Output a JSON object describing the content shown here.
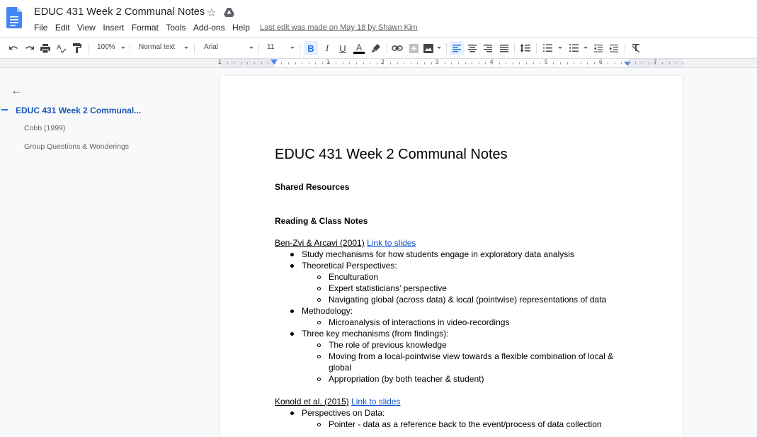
{
  "app": {
    "doc_title": "EDUC 431 Week 2 Communal Notes",
    "last_edit": "Last edit was made on May 18 by Shawn Kim",
    "menu": [
      "File",
      "Edit",
      "View",
      "Insert",
      "Format",
      "Tools",
      "Add-ons",
      "Help"
    ],
    "brand_color": "#4285f4"
  },
  "toolbar": {
    "zoom": "100%",
    "style": "Normal text",
    "font": "Arial",
    "size": "11",
    "icons": [
      "undo-icon",
      "redo-icon",
      "print-icon",
      "spellcheck-icon",
      "paint-format-icon",
      "bold-icon",
      "italic-icon",
      "underline-icon",
      "text-color-icon",
      "highlight-icon",
      "link-icon",
      "comment-icon",
      "image-icon",
      "align-left-icon",
      "align-center-icon",
      "align-right-icon",
      "justify-icon",
      "line-spacing-icon",
      "numbered-list-icon",
      "bulleted-list-icon",
      "decrease-indent-icon",
      "increase-indent-icon",
      "clear-formatting-icon"
    ]
  },
  "ruler": {
    "labels": [
      "1",
      "1",
      "2",
      "3",
      "4",
      "5",
      "6",
      "7"
    ]
  },
  "outline": {
    "title": "EDUC 431 Week 2 Communal...",
    "items": [
      "Cobb (1999)",
      "Group Questions & Wonderings"
    ]
  },
  "document": {
    "title": "EDUC 431 Week 2 Communal Notes",
    "h_shared": "Shared Resources",
    "h_reading": "Reading & Class Notes",
    "ref1": {
      "cite": "Ben-Zvi & Arcavi (2001)",
      "link": "Link to slides"
    },
    "ref1_items": [
      {
        "level": 1,
        "text": "Study mechanisms for how students engage in exploratory data analysis"
      },
      {
        "level": 1,
        "text": "Theoretical Perspectives:"
      },
      {
        "level": 2,
        "text": "Enculturation"
      },
      {
        "level": 2,
        "text": "Expert statisticians’ perspective"
      },
      {
        "level": 2,
        "text": "Navigating global (across data) & local (pointwise) representations of data"
      },
      {
        "level": 1,
        "text": "Methodology:"
      },
      {
        "level": 2,
        "text": "Microanalysis of interactions in video-recordings"
      },
      {
        "level": 1,
        "text": "Three key mechanisms (from findings):"
      },
      {
        "level": 2,
        "text": "The role of previous knowledge"
      },
      {
        "level": 2,
        "text": "Moving from a local-pointwise view towards a flexible combination of local &"
      },
      {
        "level": 3,
        "text": "global"
      },
      {
        "level": 2,
        "text": "Appropriation (by both teacher & student)"
      }
    ],
    "ref2": {
      "cite": "Konold et al. (2015)",
      "link": "Link to slides"
    },
    "ref2_items": [
      {
        "level": 1,
        "text": "Perspectives on Data:"
      },
      {
        "level": 2,
        "text": "Pointer - data as a reference back to the event/process of data collection"
      }
    ]
  }
}
